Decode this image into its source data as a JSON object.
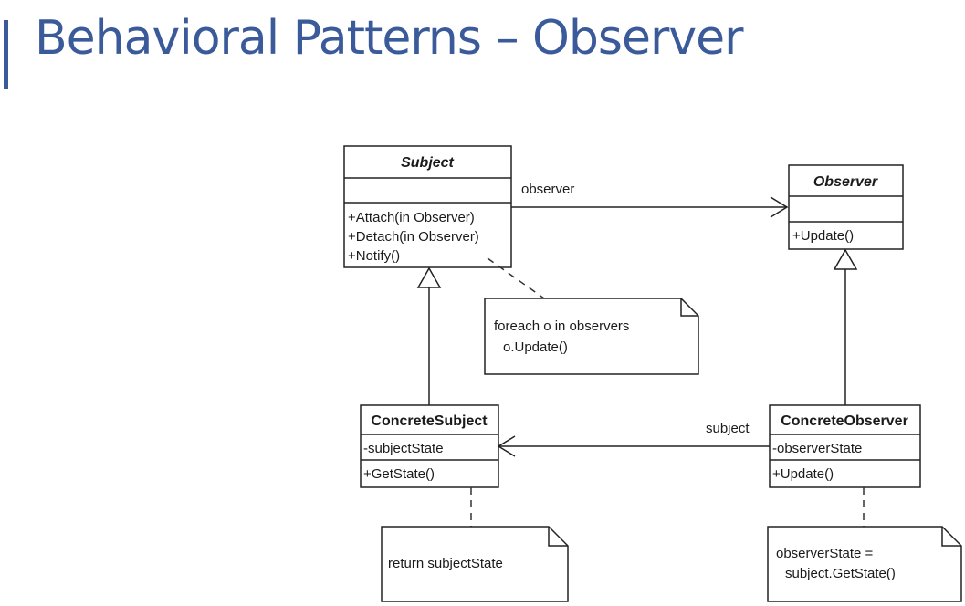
{
  "page": {
    "title": "Behavioral Patterns – Observer"
  },
  "diagram": {
    "classes": {
      "subject": {
        "name": "Subject",
        "methods": [
          "+Attach(in Observer)",
          "+Detach(in Observer)",
          "+Notify()"
        ]
      },
      "observer": {
        "name": "Observer",
        "methods": [
          "+Update()"
        ]
      },
      "concrete_subject": {
        "name": "ConcreteSubject",
        "attributes": [
          "-subjectState"
        ],
        "methods": [
          "+GetState()"
        ]
      },
      "concrete_observer": {
        "name": "ConcreteObserver",
        "attributes": [
          "-observerState"
        ],
        "methods": [
          "+Update()"
        ]
      }
    },
    "associations": {
      "subject_to_observer_label": "observer",
      "concrete_observer_to_subject_label": "subject"
    },
    "notes": {
      "notify": [
        "foreach o in observers",
        "o.Update()"
      ],
      "get_state": [
        "return subjectState"
      ],
      "update": [
        "observerState =",
        "subject.GetState()"
      ]
    },
    "colors": {
      "title": "#3b5a9a",
      "line": "#222222",
      "dashed": "#333333"
    }
  }
}
